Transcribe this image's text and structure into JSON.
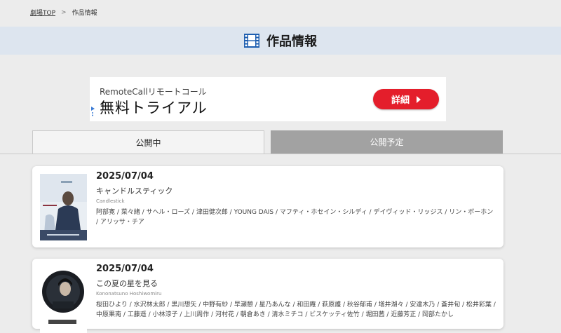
{
  "breadcrumb": {
    "home": "劇場TOP",
    "separator": ">",
    "current": "作品情報"
  },
  "page": {
    "title": "作品情報",
    "title_icon": "film-icon"
  },
  "ad": {
    "brand": "RemoteCallリモートコール",
    "headline": "無料トライアル",
    "cta_label": "詳細",
    "cta_color": "#e41e2b"
  },
  "tabs": [
    {
      "label": "公開中",
      "active": true
    },
    {
      "label": "公開予定",
      "active": false
    }
  ],
  "films": [
    {
      "date": "2025/07/04",
      "title": "キャンドルスティック",
      "romaji": "Candlestick",
      "cast": "阿部寛 / 菜々緒 / サヘル・ローズ / 津田健次郎 / YOUNG DAIS / マフティ・ホセイン・シルディ / デイヴィッド・リッジス / リン・ボーホン / アリッサ・チア"
    },
    {
      "date": "2025/07/04",
      "title": "この夏の星を見る",
      "romaji": "Kononatsuno Hoshiwomiru",
      "cast": "桜田ひより / 水沢林太郎 / 黒川想矢 / 中野有紗 / 早瀬憩 / 星乃あんな / 和田庵 / 萩原護 / 秋谷郁甫 / 増井湖々 / 安達木乃 / 蒼井旬 / 松井彩葉 / 中原果南 / 工藤遥 / 小林涼子 / 上川周作 / 河村花 / 朝倉あき / 清水ミチコ / ビスケッティ佐竹 / 堀田茜 / 近藤芳正 / 岡部たかし"
    }
  ]
}
